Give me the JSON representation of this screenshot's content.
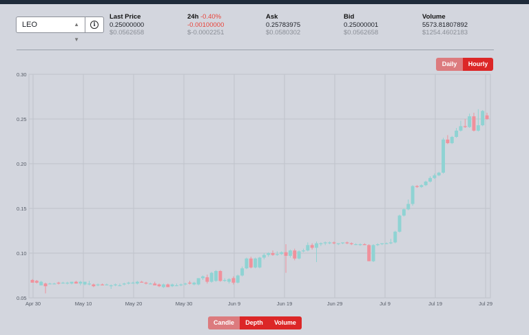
{
  "selector": {
    "value": "LEO",
    "chevron_icon": "up-down-chevron-icon",
    "info_icon": "info-circle-icon"
  },
  "stats": [
    {
      "label": "Last Price",
      "change": "",
      "value": "0.25000000",
      "usd": "$0.0562658"
    },
    {
      "label": "24h",
      "change": "-0.40%",
      "value": "-0.00100000",
      "usd": "$-0.0002251"
    },
    {
      "label": "Ask",
      "change": "",
      "value": "0.25783975",
      "usd": "$0.0580302"
    },
    {
      "label": "Bid",
      "change": "",
      "value": "0.25000001",
      "usd": "$0.0562658"
    },
    {
      "label": "Volume",
      "change": "",
      "value": "5573.81807892",
      "usd": "$1254.4602183"
    }
  ],
  "range_toggle": {
    "daily": "Daily",
    "hourly": "Hourly",
    "selected": "Hourly"
  },
  "chart_toggle": {
    "candle": "Candle",
    "depth": "Depth",
    "volume": "Volume",
    "selected": "Candle"
  },
  "colors": {
    "up": "#8fd3d3",
    "down": "#f0919c",
    "accent": "#dc2727",
    "accent_inactive": "#dc7b7e"
  },
  "chart_data": {
    "type": "candlestick",
    "ylim": [
      0.05,
      0.3
    ],
    "y_ticks": [
      "0.30",
      "0.25",
      "0.20",
      "0.15",
      "0.10",
      "0.05"
    ],
    "x_ticks": [
      "Apr 30",
      "May 10",
      "May 20",
      "May 30",
      "Jun 9",
      "Jun 19",
      "Jun 29",
      "Jul 9",
      "Jul 19",
      "Jul 29"
    ],
    "grid": true,
    "candles": [
      [
        0.07,
        0.071,
        0.068,
        0.067
      ],
      [
        0.069,
        0.07,
        0.066,
        0.067
      ],
      [
        0.064,
        0.069,
        0.064,
        0.068
      ],
      [
        0.066,
        0.067,
        0.055,
        0.063
      ],
      [
        0.066,
        0.067,
        0.065,
        0.066
      ],
      [
        0.066,
        0.067,
        0.065,
        0.066
      ],
      [
        0.067,
        0.068,
        0.065,
        0.066
      ],
      [
        0.066,
        0.068,
        0.066,
        0.067
      ],
      [
        0.066,
        0.068,
        0.065,
        0.067
      ],
      [
        0.066,
        0.068,
        0.065,
        0.068
      ],
      [
        0.068,
        0.069,
        0.066,
        0.066
      ],
      [
        0.066,
        0.069,
        0.064,
        0.068
      ],
      [
        0.065,
        0.068,
        0.064,
        0.068
      ],
      [
        0.065,
        0.069,
        0.064,
        0.066
      ],
      [
        0.065,
        0.066,
        0.062,
        0.063
      ],
      [
        0.064,
        0.066,
        0.063,
        0.065
      ],
      [
        0.065,
        0.066,
        0.064,
        0.064
      ],
      [
        0.064,
        0.066,
        0.064,
        0.065
      ],
      [
        0.063,
        0.065,
        0.06,
        0.064
      ],
      [
        0.064,
        0.066,
        0.063,
        0.065
      ],
      [
        0.064,
        0.066,
        0.063,
        0.064
      ],
      [
        0.065,
        0.067,
        0.064,
        0.066
      ],
      [
        0.066,
        0.068,
        0.065,
        0.067
      ],
      [
        0.066,
        0.068,
        0.066,
        0.067
      ],
      [
        0.066,
        0.069,
        0.065,
        0.068
      ],
      [
        0.068,
        0.069,
        0.067,
        0.067
      ],
      [
        0.067,
        0.068,
        0.065,
        0.066
      ],
      [
        0.066,
        0.067,
        0.065,
        0.066
      ],
      [
        0.066,
        0.068,
        0.064,
        0.064
      ],
      [
        0.065,
        0.066,
        0.062,
        0.063
      ],
      [
        0.062,
        0.066,
        0.061,
        0.065
      ],
      [
        0.065,
        0.066,
        0.062,
        0.062
      ],
      [
        0.063,
        0.066,
        0.062,
        0.065
      ],
      [
        0.064,
        0.066,
        0.063,
        0.064
      ],
      [
        0.064,
        0.066,
        0.063,
        0.065
      ],
      [
        0.065,
        0.067,
        0.064,
        0.066
      ],
      [
        0.067,
        0.069,
        0.065,
        0.066
      ],
      [
        0.065,
        0.068,
        0.064,
        0.067
      ],
      [
        0.065,
        0.072,
        0.064,
        0.072
      ],
      [
        0.072,
        0.075,
        0.07,
        0.074
      ],
      [
        0.073,
        0.076,
        0.066,
        0.068
      ],
      [
        0.068,
        0.079,
        0.067,
        0.078
      ],
      [
        0.069,
        0.081,
        0.068,
        0.08
      ],
      [
        0.08,
        0.081,
        0.068,
        0.069
      ],
      [
        0.069,
        0.072,
        0.068,
        0.07
      ],
      [
        0.068,
        0.072,
        0.066,
        0.071
      ],
      [
        0.072,
        0.074,
        0.065,
        0.067
      ],
      [
        0.067,
        0.076,
        0.066,
        0.075
      ],
      [
        0.075,
        0.085,
        0.074,
        0.083
      ],
      [
        0.083,
        0.095,
        0.082,
        0.094
      ],
      [
        0.094,
        0.096,
        0.083,
        0.084
      ],
      [
        0.084,
        0.095,
        0.083,
        0.094
      ],
      [
        0.084,
        0.096,
        0.083,
        0.095
      ],
      [
        0.095,
        0.1,
        0.093,
        0.098
      ],
      [
        0.098,
        0.101,
        0.096,
        0.1
      ],
      [
        0.1,
        0.103,
        0.097,
        0.098
      ],
      [
        0.098,
        0.102,
        0.097,
        0.099
      ],
      [
        0.099,
        0.102,
        0.098,
        0.101
      ],
      [
        0.101,
        0.11,
        0.078,
        0.097
      ],
      [
        0.097,
        0.104,
        0.095,
        0.103
      ],
      [
        0.103,
        0.105,
        0.092,
        0.094
      ],
      [
        0.094,
        0.103,
        0.093,
        0.102
      ],
      [
        0.102,
        0.105,
        0.101,
        0.103
      ],
      [
        0.103,
        0.112,
        0.102,
        0.109
      ],
      [
        0.109,
        0.111,
        0.104,
        0.106
      ],
      [
        0.106,
        0.113,
        0.09,
        0.111
      ],
      [
        0.11,
        0.112,
        0.108,
        0.111
      ],
      [
        0.111,
        0.113,
        0.109,
        0.112
      ],
      [
        0.111,
        0.113,
        0.11,
        0.112
      ],
      [
        0.112,
        0.113,
        0.11,
        0.111
      ],
      [
        0.11,
        0.111,
        0.109,
        0.111
      ],
      [
        0.111,
        0.112,
        0.11,
        0.112
      ],
      [
        0.112,
        0.113,
        0.11,
        0.111
      ],
      [
        0.111,
        0.112,
        0.109,
        0.11
      ],
      [
        0.11,
        0.111,
        0.109,
        0.11
      ],
      [
        0.109,
        0.111,
        0.108,
        0.11
      ],
      [
        0.11,
        0.111,
        0.109,
        0.109
      ],
      [
        0.109,
        0.11,
        0.091,
        0.091
      ],
      [
        0.091,
        0.11,
        0.09,
        0.109
      ],
      [
        0.109,
        0.111,
        0.108,
        0.11
      ],
      [
        0.11,
        0.111,
        0.109,
        0.111
      ],
      [
        0.111,
        0.112,
        0.11,
        0.111
      ],
      [
        0.111,
        0.116,
        0.11,
        0.112
      ],
      [
        0.112,
        0.125,
        0.111,
        0.124
      ],
      [
        0.124,
        0.143,
        0.123,
        0.142
      ],
      [
        0.142,
        0.15,
        0.141,
        0.149
      ],
      [
        0.149,
        0.16,
        0.148,
        0.155
      ],
      [
        0.155,
        0.176,
        0.153,
        0.175
      ],
      [
        0.175,
        0.176,
        0.173,
        0.174
      ],
      [
        0.174,
        0.177,
        0.173,
        0.176
      ],
      [
        0.176,
        0.181,
        0.175,
        0.18
      ],
      [
        0.18,
        0.186,
        0.179,
        0.184
      ],
      [
        0.184,
        0.189,
        0.183,
        0.187
      ],
      [
        0.187,
        0.191,
        0.186,
        0.19
      ],
      [
        0.19,
        0.229,
        0.189,
        0.227
      ],
      [
        0.227,
        0.232,
        0.222,
        0.223
      ],
      [
        0.223,
        0.231,
        0.222,
        0.23
      ],
      [
        0.23,
        0.24,
        0.229,
        0.237
      ],
      [
        0.237,
        0.248,
        0.236,
        0.242
      ],
      [
        0.242,
        0.25,
        0.24,
        0.241
      ],
      [
        0.241,
        0.256,
        0.24,
        0.253
      ],
      [
        0.253,
        0.257,
        0.236,
        0.237
      ],
      [
        0.237,
        0.261,
        0.236,
        0.243
      ],
      [
        0.243,
        0.26,
        0.242,
        0.259
      ],
      [
        0.254,
        0.257,
        0.249,
        0.25
      ]
    ]
  }
}
